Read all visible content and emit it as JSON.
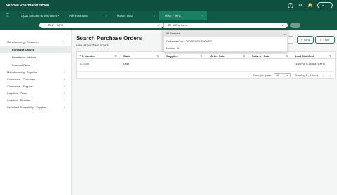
{
  "app": {
    "brand": "Kendall Pharmaceuticals"
  },
  "topbar": {
    "help_icon": "?",
    "bell_icon": "🔔",
    "cloud_icon": "☁",
    "cloud_caret": "⌄"
  },
  "tabs": [
    {
      "label": "Opus Solution Environment",
      "close": "×"
    },
    {
      "label": "Administration",
      "close": "×"
    },
    {
      "label": "Master Data",
      "close": "×"
    },
    {
      "label": "MINT - MFC",
      "close": "×"
    }
  ],
  "search": {
    "context_value": "MINT - MFC",
    "partner_value": "All Partners",
    "caret": "⌄"
  },
  "dropdown": {
    "options": [
      "All Partners",
      "GsPartnerCorp1202411080511600831",
      "Mexico Ltd"
    ]
  },
  "sidebar": {
    "collapse_icon": "‹",
    "items": [
      {
        "label": "Manufacturing - Customer",
        "chev": "⌃"
      },
      {
        "label": "Purchase Orders"
      },
      {
        "label": "Remittance Advices"
      },
      {
        "label": "Forecast Plans"
      },
      {
        "label": "Manufacturing - Supplier",
        "chev": "›"
      },
      {
        "label": "Commerce - Customer",
        "chev": "›"
      },
      {
        "label": "Commerce - Supplier",
        "chev": "›"
      },
      {
        "label": "Logistics - Client",
        "chev": "›"
      },
      {
        "label": "Logistics - Provider",
        "chev": "›"
      },
      {
        "label": "Serialized Traceability - Supplier",
        "chev": "›"
      }
    ]
  },
  "page": {
    "title": "Search Purchase Orders",
    "subtitle": "View all purchase orders.",
    "new_label": "New",
    "new_icon": "+",
    "filter_label": "Filter",
    "filter_icon": "⩩"
  },
  "table": {
    "columns": [
      "PO Number",
      "State",
      "Supplier",
      "Order Date",
      "Delivery Date",
      "Last Modified"
    ],
    "sort_icon": "⇅",
    "rows": [
      {
        "po": "123456",
        "state": "Draft",
        "supplier": "",
        "order_date": "",
        "delivery_date": "",
        "last_modified": "1/10/25, 8:38 AM (GMT)"
      }
    ],
    "rows_per_page_label": "Rows per page:",
    "rows_per_page_value": "10",
    "showing": "Showing 1 - 1 items",
    "prev_icon": "‹",
    "next_icon": "›"
  }
}
